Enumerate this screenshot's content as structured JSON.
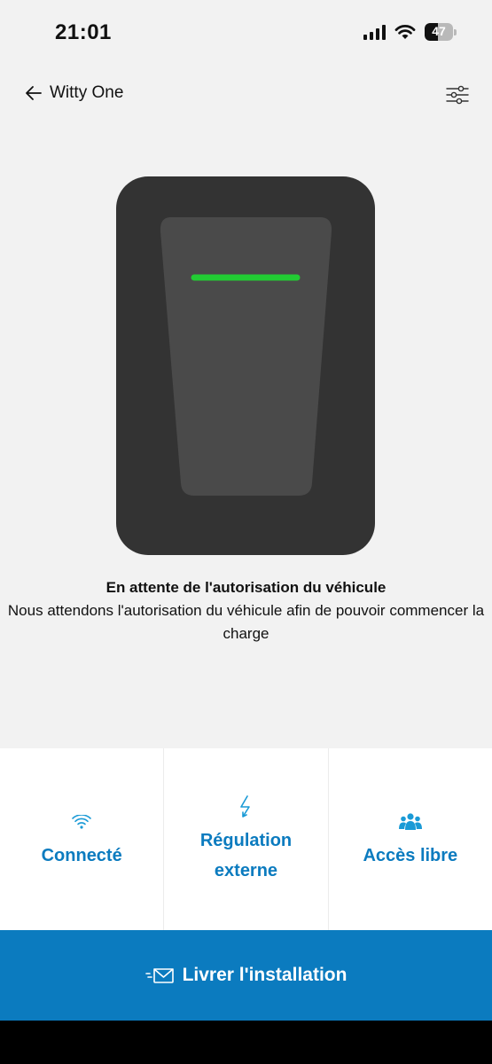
{
  "status_bar": {
    "time": "21:01",
    "battery_level": "47",
    "icons": [
      "signal-icon",
      "wifi-icon",
      "battery-icon"
    ]
  },
  "header": {
    "back_icon": "arrow-left-icon",
    "title": "Witty One",
    "settings_icon": "sliders-icon"
  },
  "charger": {
    "indicator_color": "#22cc33",
    "body_color": "#333333"
  },
  "status": {
    "title": "En attente de l'autorisation du véhicule",
    "description": "Nous attendons l'autorisation du véhicule afin de pouvoir commencer la charge"
  },
  "tiles": [
    {
      "icon": "wifi-icon",
      "label": "Connecté"
    },
    {
      "icon": "lightning-icon",
      "label": "Régulation externe"
    },
    {
      "icon": "users-icon",
      "label": "Accès libre"
    }
  ],
  "action": {
    "icon": "send-mail-icon",
    "label": "Livrer l'installation"
  },
  "colors": {
    "accent": "#0b7bbf",
    "background": "#f2f2f2"
  }
}
